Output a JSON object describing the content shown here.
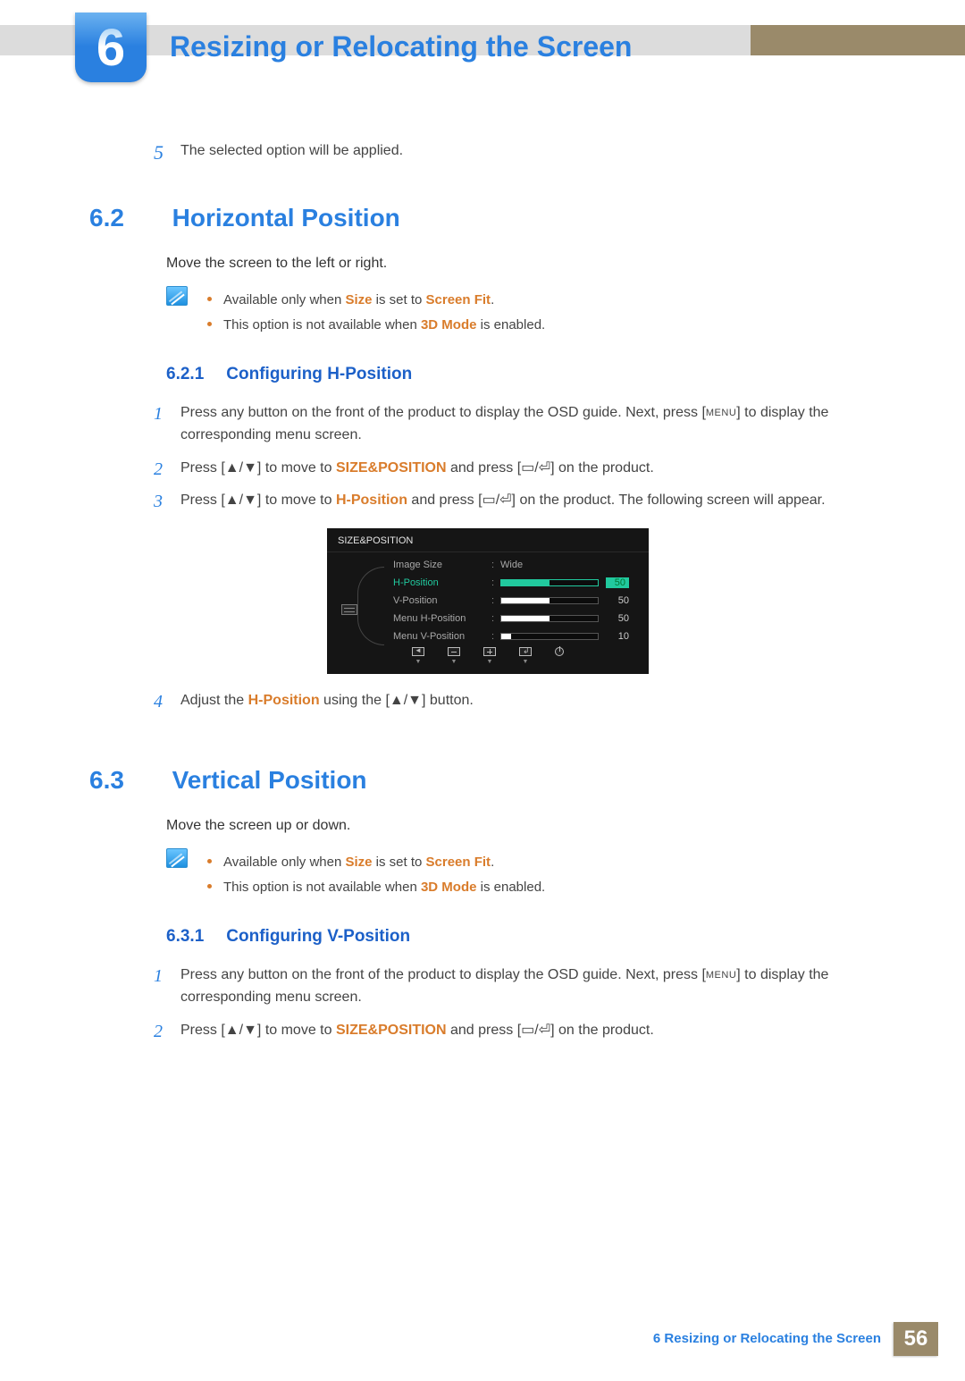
{
  "chapter": {
    "number": "6",
    "title": "Resizing or Relocating the Screen"
  },
  "intro_step": {
    "num": "5",
    "text": "The selected option will be applied."
  },
  "sec62": {
    "num": "6.2",
    "title": "Horizontal Position",
    "para": "Move the screen to the left or right.",
    "note1_a": "Available only when ",
    "note1_b": "Size",
    "note1_c": " is set to ",
    "note1_d": "Screen Fit",
    "note1_e": ".",
    "note2_a": "This option is not available when ",
    "note2_b": "3D Mode",
    "note2_c": " is enabled.",
    "sub": {
      "num": "6.2.1",
      "title": "Configuring H-Position"
    },
    "steps": {
      "s1a": "Press any button on the front of the product to display the OSD guide. Next, press [",
      "s1b": "MENU",
      "s1c": "] to display the corresponding menu screen.",
      "s2a": "Press [",
      "s2b": "▲/▼",
      "s2c": "] to move to ",
      "s2d": "SIZE&POSITION",
      "s2e": " and press [",
      "s2f": "▭/⏎",
      "s2g": "] on the product.",
      "s3a": "Press [",
      "s3b": "▲/▼",
      "s3c": "] to move to ",
      "s3d": "H-Position",
      "s3e": " and press [",
      "s3f": "▭/⏎",
      "s3g": "] on the product. The following screen will appear.",
      "s4a": "Adjust the ",
      "s4b": "H-Position",
      "s4c": " using the [",
      "s4d": "▲/▼",
      "s4e": "] button."
    }
  },
  "osd": {
    "title": "SIZE&POSITION",
    "rows": [
      {
        "label": "Image Size",
        "value_text": "Wide"
      },
      {
        "label": "H-Position",
        "value_num": "50",
        "fill": 50,
        "selected": true
      },
      {
        "label": "V-Position",
        "value_num": "50",
        "fill": 50
      },
      {
        "label": "Menu H-Position",
        "value_num": "50",
        "fill": 50
      },
      {
        "label": "Menu V-Position",
        "value_num": "10",
        "fill": 10
      }
    ]
  },
  "sec63": {
    "num": "6.3",
    "title": "Vertical Position",
    "para": "Move the screen up or down.",
    "note1_a": "Available only when ",
    "note1_b": "Size",
    "note1_c": " is set to ",
    "note1_d": "Screen Fit",
    "note1_e": ".",
    "note2_a": "This option is not available when ",
    "note2_b": "3D Mode",
    "note2_c": " is enabled.",
    "sub": {
      "num": "6.3.1",
      "title": "Configuring V-Position"
    },
    "steps": {
      "s1a": "Press any button on the front of the product to display the OSD guide. Next, press [",
      "s1b": "MENU",
      "s1c": "] to display the corresponding menu screen.",
      "s2a": "Press [",
      "s2b": "▲/▼",
      "s2c": "] to move to ",
      "s2d": "SIZE&POSITION",
      "s2e": " and press [",
      "s2f": "▭/⏎",
      "s2g": "] on the product."
    }
  },
  "footer": {
    "label": "6 Resizing or Relocating the Screen",
    "page": "56"
  }
}
